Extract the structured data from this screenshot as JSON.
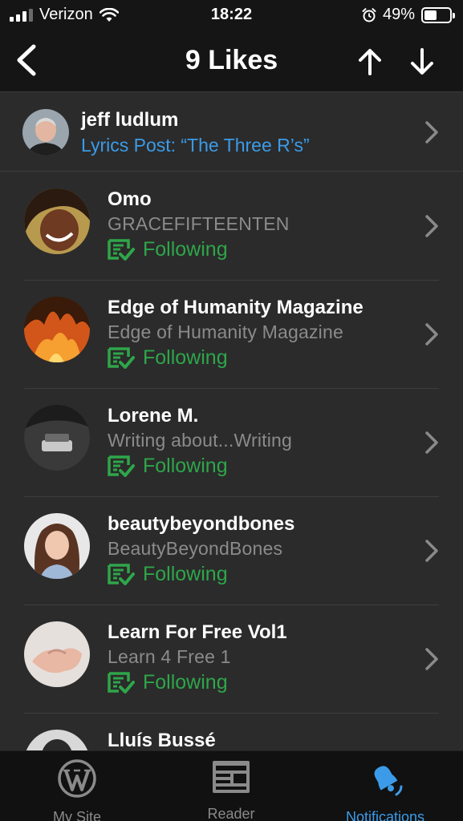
{
  "status_bar": {
    "carrier": "Verizon",
    "time": "18:22",
    "battery": "49%",
    "battery_level": 0.49
  },
  "nav": {
    "title": "9 Likes"
  },
  "post": {
    "author": "jeff ludlum",
    "link": "Lyrics Post:  “The Three R’s”"
  },
  "likes": [
    {
      "name": "Omo",
      "site": "GRACEFIFTEENTEN",
      "status": "Following"
    },
    {
      "name": "Edge of Humanity Magazine",
      "site": "Edge of Humanity Magazine",
      "status": "Following"
    },
    {
      "name": "Lorene M.",
      "site": "Writing about...Writing",
      "status": "Following"
    },
    {
      "name": "beautybeyondbones",
      "site": "BeautyBeyondBones",
      "status": "Following"
    },
    {
      "name": "Learn For Free Vol1",
      "site": "Learn 4 Free 1",
      "status": "Following"
    },
    {
      "name": "Lluís Bussé",
      "site": "",
      "status": ""
    }
  ],
  "tabs": {
    "my_site": "My Site",
    "reader": "Reader",
    "notifications": "Notifications"
  },
  "colors": {
    "accent_blue": "#3b9be8",
    "following_green": "#2ea64a",
    "background": "#2b2b2b"
  }
}
